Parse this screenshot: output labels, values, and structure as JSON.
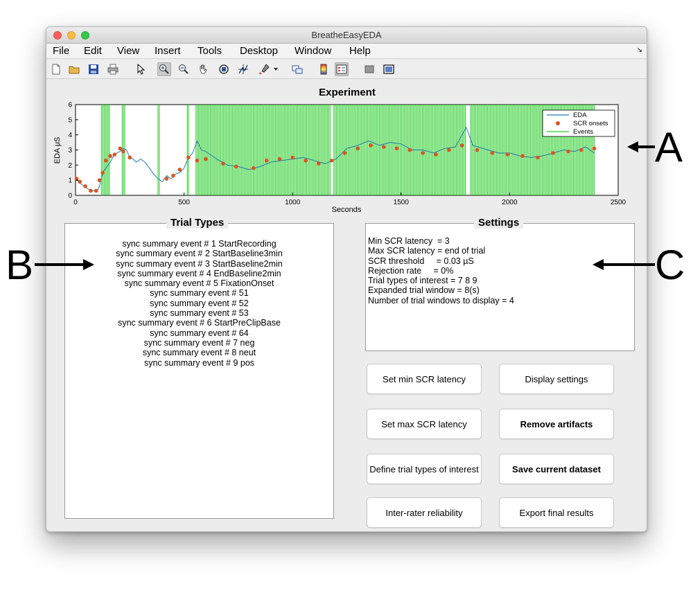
{
  "window": {
    "title": "BreatheEasyEDA"
  },
  "menu": [
    "File",
    "Edit",
    "View",
    "Insert",
    "Tools",
    "Desktop",
    "Window",
    "Help"
  ],
  "toolbar_icons": [
    "new-file-icon",
    "open-folder-icon",
    "save-icon",
    "print-icon",
    "pointer-icon",
    "zoom-in-icon",
    "zoom-out-icon",
    "pan-hand-icon",
    "rotate-3d-icon",
    "data-cursor-icon",
    "brush-icon",
    "link-plot-icon",
    "colorbar-icon",
    "legend-icon",
    "hide-tools-icon",
    "dock-icon"
  ],
  "chart_data": {
    "type": "line",
    "title": "Experiment",
    "xlabel": "Seconds",
    "ylabel": "EDA μS",
    "xlim": [
      0,
      2500
    ],
    "ylim": [
      0,
      6
    ],
    "xticks": [
      0,
      500,
      1000,
      1500,
      2000,
      2500
    ],
    "yticks": [
      0,
      1,
      2,
      3,
      4,
      5,
      6
    ],
    "legend": [
      "EDA",
      "SCR onsets",
      "Events"
    ],
    "legend_position": "top-right",
    "colors": {
      "eda": "#1f77b4",
      "scr": "#e0531f",
      "events": "#22cc22"
    },
    "eda": [
      [
        0,
        1.1
      ],
      [
        20,
        0.8
      ],
      [
        40,
        0.6
      ],
      [
        60,
        0.4
      ],
      [
        80,
        0.3
      ],
      [
        100,
        0.3
      ],
      [
        110,
        0.6
      ],
      [
        120,
        1.2
      ],
      [
        130,
        1.6
      ],
      [
        140,
        1.8
      ],
      [
        150,
        2.0
      ],
      [
        160,
        2.2
      ],
      [
        175,
        2.6
      ],
      [
        190,
        2.8
      ],
      [
        205,
        2.9
      ],
      [
        220,
        3.1
      ],
      [
        235,
        3.0
      ],
      [
        250,
        2.5
      ],
      [
        265,
        2.4
      ],
      [
        280,
        2.2
      ],
      [
        300,
        2.4
      ],
      [
        320,
        2.2
      ],
      [
        340,
        1.8
      ],
      [
        360,
        1.4
      ],
      [
        380,
        1.1
      ],
      [
        400,
        0.9
      ],
      [
        420,
        1.3
      ],
      [
        440,
        1.1
      ],
      [
        460,
        1.4
      ],
      [
        480,
        1.5
      ],
      [
        500,
        1.8
      ],
      [
        520,
        2.5
      ],
      [
        540,
        2.8
      ],
      [
        560,
        3.6
      ],
      [
        580,
        3.0
      ],
      [
        600,
        2.9
      ],
      [
        650,
        2.4
      ],
      [
        700,
        2.0
      ],
      [
        750,
        1.9
      ],
      [
        800,
        1.7
      ],
      [
        850,
        1.9
      ],
      [
        900,
        2.2
      ],
      [
        950,
        2.3
      ],
      [
        1000,
        2.4
      ],
      [
        1050,
        2.5
      ],
      [
        1100,
        2.3
      ],
      [
        1150,
        2.1
      ],
      [
        1200,
        2.4
      ],
      [
        1250,
        3.1
      ],
      [
        1300,
        3.3
      ],
      [
        1350,
        3.6
      ],
      [
        1400,
        3.3
      ],
      [
        1450,
        3.5
      ],
      [
        1500,
        3.4
      ],
      [
        1550,
        3.0
      ],
      [
        1600,
        3.0
      ],
      [
        1650,
        2.8
      ],
      [
        1700,
        3.1
      ],
      [
        1750,
        3.2
      ],
      [
        1800,
        4.5
      ],
      [
        1830,
        3.3
      ],
      [
        1900,
        3.0
      ],
      [
        1950,
        2.8
      ],
      [
        2000,
        2.8
      ],
      [
        2050,
        2.6
      ],
      [
        2100,
        2.5
      ],
      [
        2150,
        2.6
      ],
      [
        2200,
        2.8
      ],
      [
        2250,
        3.0
      ],
      [
        2300,
        2.9
      ],
      [
        2350,
        3.2
      ],
      [
        2390,
        2.8
      ]
    ],
    "scr_onsets": [
      [
        5,
        1.1
      ],
      [
        20,
        0.9
      ],
      [
        45,
        0.6
      ],
      [
        70,
        0.3
      ],
      [
        95,
        0.3
      ],
      [
        110,
        1.0
      ],
      [
        125,
        1.5
      ],
      [
        140,
        2.3
      ],
      [
        160,
        2.6
      ],
      [
        180,
        2.7
      ],
      [
        205,
        3.1
      ],
      [
        220,
        2.9
      ],
      [
        250,
        2.5
      ],
      [
        420,
        1.1
      ],
      [
        450,
        1.3
      ],
      [
        480,
        1.7
      ],
      [
        520,
        2.5
      ],
      [
        560,
        2.3
      ],
      [
        600,
        2.4
      ],
      [
        680,
        2.1
      ],
      [
        740,
        1.9
      ],
      [
        820,
        1.8
      ],
      [
        880,
        2.3
      ],
      [
        940,
        2.4
      ],
      [
        1000,
        2.5
      ],
      [
        1060,
        2.3
      ],
      [
        1120,
        2.1
      ],
      [
        1180,
        2.3
      ],
      [
        1240,
        2.8
      ],
      [
        1300,
        3.1
      ],
      [
        1360,
        3.3
      ],
      [
        1420,
        3.2
      ],
      [
        1480,
        3.1
      ],
      [
        1540,
        3.0
      ],
      [
        1600,
        2.8
      ],
      [
        1660,
        2.7
      ],
      [
        1720,
        3.0
      ],
      [
        1780,
        3.3
      ],
      [
        1850,
        3.0
      ],
      [
        1920,
        2.8
      ],
      [
        1990,
        2.7
      ],
      [
        2060,
        2.6
      ],
      [
        2130,
        2.5
      ],
      [
        2200,
        2.8
      ],
      [
        2270,
        2.9
      ],
      [
        2330,
        3.0
      ],
      [
        2390,
        3.1
      ]
    ],
    "events": [
      [
        120,
        160
      ],
      [
        215,
        230
      ],
      [
        380,
        390
      ],
      [
        515,
        525
      ],
      [
        555,
        1175
      ],
      [
        1190,
        1800
      ],
      [
        1820,
        2395
      ]
    ]
  },
  "panels": {
    "trial_types": {
      "title": "Trial Types",
      "items": [
        "sync summary event # 1 StartRecording",
        "sync summary event # 2 StartBaseline3min",
        "sync summary event # 3 StartBaseline2min",
        "sync summary event # 4 EndBaseline2min",
        "sync summary event # 5 FixationOnset",
        "sync summary event # 51",
        "sync summary event # 52",
        "sync summary event # 53",
        "sync summary event # 6 StartPreClipBase",
        "sync summary event # 64",
        "sync summary event # 7 neg",
        "sync summary event # 8 neut",
        "sync summary event # 9 pos"
      ]
    },
    "settings": {
      "title": "Settings",
      "lines": [
        "Min SCR latency  = 3",
        "Max SCR latency = end of trial",
        "SCR threshold     = 0.03 µS",
        "Rejection rate     = 0%",
        "Trial types of interest = 7 8 9",
        "Expanded trial window = 8(s)",
        "Number of trial windows to display = 4"
      ]
    }
  },
  "buttons": {
    "set_min": "Set min SCR latency",
    "display_settings": "Display settings",
    "set_max": "Set max SCR latency",
    "remove_artifacts": "Remove artifacts",
    "define_trial": "Define trial types of interest",
    "save_dataset": "Save current dataset",
    "inter_rater": "Inter-rater reliability",
    "export_results": "Export final results"
  },
  "callouts": {
    "a": "A",
    "b": "B",
    "c": "C"
  }
}
